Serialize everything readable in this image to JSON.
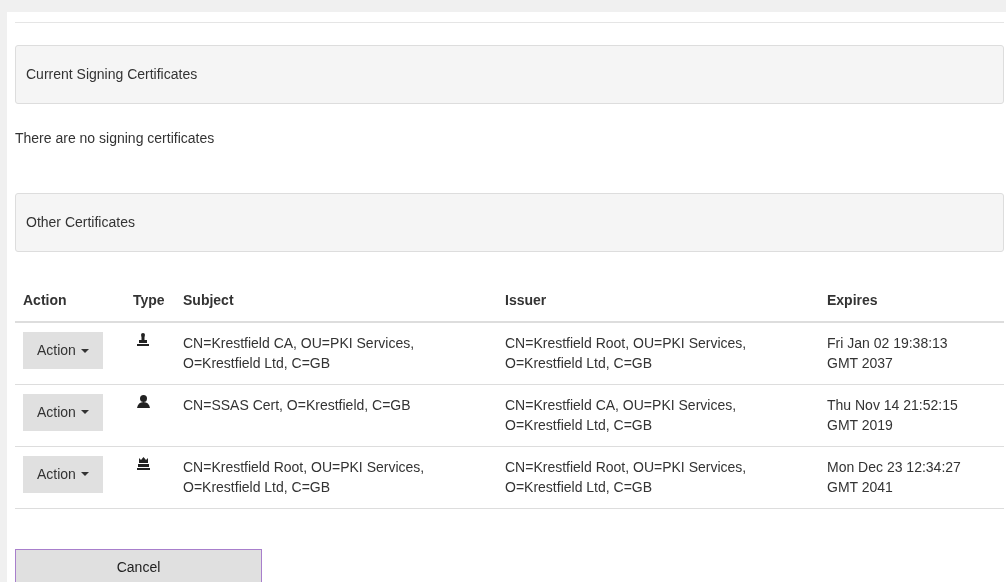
{
  "sections": [
    {
      "heading": "Current Signing Certificates",
      "empty_message": "There are no signing certificates"
    },
    {
      "heading": "Other Certificates"
    }
  ],
  "table": {
    "columns": [
      "Action",
      "Type",
      "Subject",
      "Issuer",
      "Expires"
    ],
    "rows": [
      {
        "action": "Action",
        "kind": "ca",
        "subject": "CN=Krestfield CA, OU=PKI Services, O=Krestfield Ltd, C=GB",
        "issuer": "CN=Krestfield Root, OU=PKI Services, O=Krestfield Ltd, C=GB",
        "expires": "Fri Jan 02 19:38:13 GMT 2037"
      },
      {
        "action": "Action",
        "kind": "user",
        "subject": "CN=SSAS Cert, O=Krestfield, C=GB",
        "issuer": "CN=Krestfield CA, OU=PKI Services, O=Krestfield Ltd, C=GB",
        "expires": "Thu Nov 14 21:52:15 GMT 2019"
      },
      {
        "action": "Action",
        "kind": "root",
        "subject": "CN=Krestfield Root, OU=PKI Services, O=Krestfield Ltd, C=GB",
        "issuer": "CN=Krestfield Root, OU=PKI Services, O=Krestfield Ltd, C=GB",
        "expires": "Mon Dec 23 12:34:27 GMT 2041"
      }
    ]
  },
  "buttons": [
    {
      "label": "Cancel"
    }
  ]
}
